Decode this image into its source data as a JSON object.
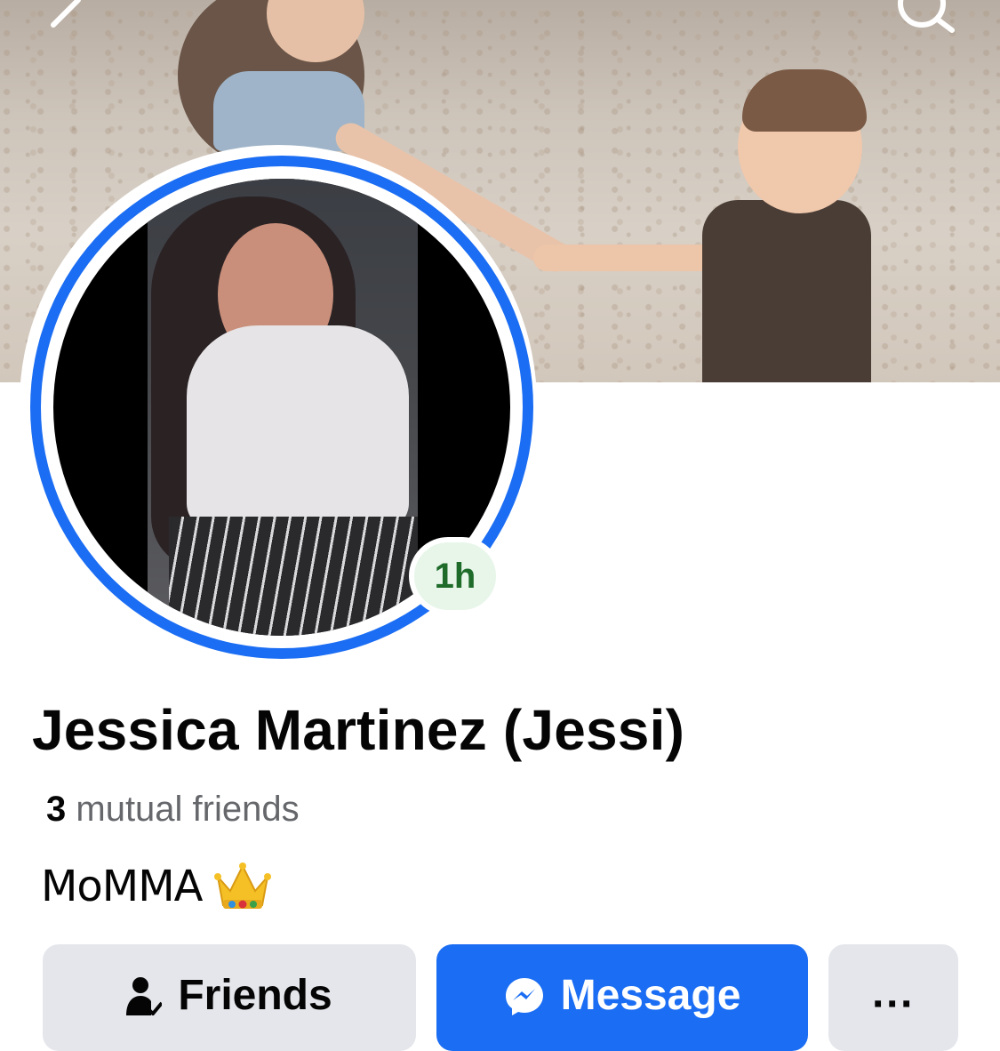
{
  "profile": {
    "name": "Jessica Martinez (Jessi)",
    "story_age": "1h",
    "mutual_count": "3",
    "mutual_label": "mutual friends",
    "bio": "MoMMA"
  },
  "actions": {
    "friends_label": "Friends",
    "message_label": "Message",
    "more_label": "···"
  },
  "colors": {
    "accent": "#1b6df3",
    "button_gray": "#e4e6eb",
    "badge_bg": "#e8f6ea",
    "badge_text": "#1e6b2a"
  },
  "icons": {
    "back": "chevron-left-icon",
    "search": "search-icon",
    "friends": "friend-check-icon",
    "message": "messenger-icon",
    "crown": "crown-emoji"
  }
}
